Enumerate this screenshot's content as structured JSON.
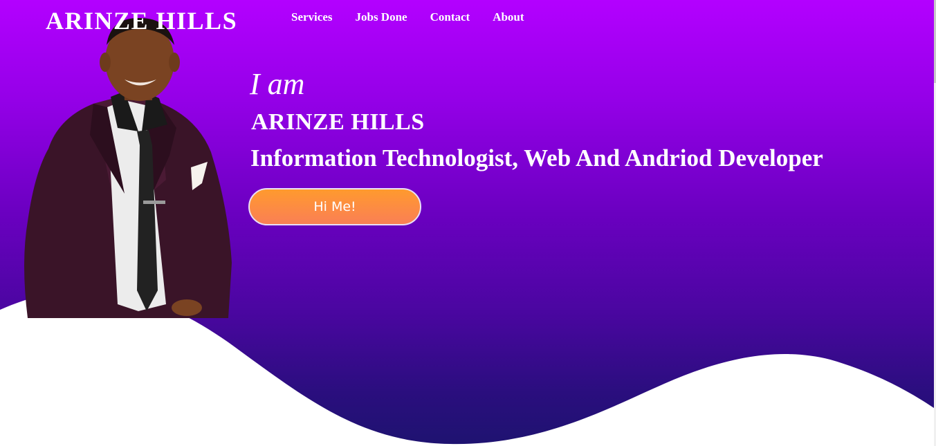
{
  "brand": {
    "logo_text": "ARINZE HILLS"
  },
  "nav": {
    "items": [
      "Services",
      "Jobs Done",
      "Contact",
      "About"
    ]
  },
  "hero": {
    "intro": "I am",
    "name": "ARINZE HILLS",
    "role": "Information Technologist, Web And Andriod Developer",
    "cta_label": "Hi Me!"
  },
  "colors": {
    "gradient_top": "#b300ff",
    "gradient_bottom": "#1e1370",
    "cta_top": "#ff9a2e",
    "cta_bottom": "#fa7f55",
    "text": "#ffffff",
    "wave": "#ffffff"
  }
}
